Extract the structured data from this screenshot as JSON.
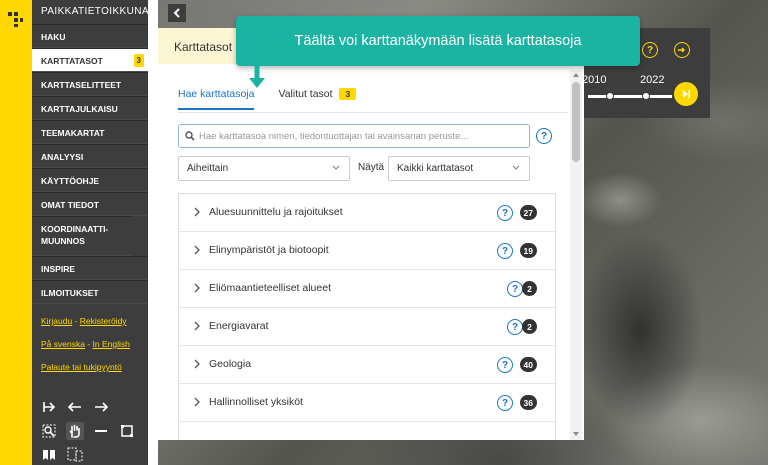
{
  "sidebar": {
    "brand": "PAIKKATIETOIKKUNA",
    "items": [
      {
        "label": "HAKU"
      },
      {
        "label": "KARTTATASOT",
        "badge": "3"
      },
      {
        "label": "KARTTASELITTEET"
      },
      {
        "label": "KARTTAJULKAISU"
      },
      {
        "label": "TEEMAKARTAT"
      },
      {
        "label": "ANALYYSI"
      },
      {
        "label": "KÄYTTÖOHJE"
      },
      {
        "label": "OMAT TIEDOT"
      },
      {
        "label": "KOORDINAATTI-MUUNNOS"
      },
      {
        "label": "INSPIRE"
      },
      {
        "label": "ILMOITUKSET"
      }
    ],
    "links": {
      "login": "Kirjaudu",
      "register": "Rekisteröidy",
      "swedish": "På svenska",
      "english": "In English",
      "feedback": "Palaute tai tukipyyntö",
      "separator": "-"
    }
  },
  "timeline": {
    "year_start": "2010",
    "year_end": "2022"
  },
  "panel": {
    "title": "Karttatasot",
    "tabs": [
      {
        "label": "Hae karttatasoja"
      },
      {
        "label": "Valitut tasot",
        "badge": "3"
      }
    ],
    "search": {
      "placeholder": "Hae karttatasoa nimen, tiedontuottajan tai avainsanan peruste..."
    },
    "group_select": "Aiheittain",
    "show_label": "Näytä",
    "show_select": "Kaikki karttatasot",
    "list": [
      {
        "name": "Aluesuunnittelu ja rajoitukset",
        "count": "27"
      },
      {
        "name": "Elinympäristöt ja biotoopit",
        "count": "19"
      },
      {
        "name": "Eliömaantieteelliset alueet",
        "count": "2"
      },
      {
        "name": "Energiavarat",
        "count": "2"
      },
      {
        "name": "Geologia",
        "count": "40"
      },
      {
        "name": "Hallinnolliset yksiköt",
        "count": "36"
      }
    ]
  },
  "callout": {
    "text": "Täältä voi karttanäkymään lisätä karttatasoja"
  },
  "colors": {
    "accent_yellow": "#ffd800",
    "sidebar_bg": "#3d3d3d",
    "tab_blue": "#1a73c9",
    "callout_teal": "#1bb3a2"
  }
}
